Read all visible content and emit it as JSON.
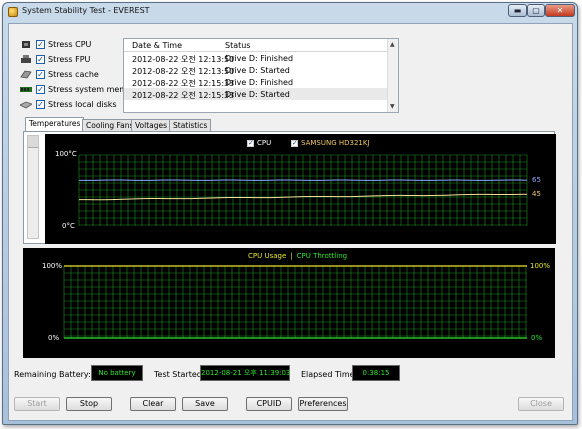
{
  "window": {
    "title": "System Stability Test - EVEREST",
    "min_glyph": "▬",
    "max_glyph": "▢",
    "close_glyph": "✕"
  },
  "stress_options": [
    {
      "label": "Stress CPU",
      "icon": "cpu-icon",
      "checked": "✓"
    },
    {
      "label": "Stress FPU",
      "icon": "fpu-icon",
      "checked": "✓"
    },
    {
      "label": "Stress cache",
      "icon": "cache-icon",
      "checked": "✓"
    },
    {
      "label": "Stress system memory",
      "icon": "memory-icon",
      "checked": "✓"
    },
    {
      "label": "Stress local disks",
      "icon": "disk-icon",
      "checked": "✓"
    }
  ],
  "log": {
    "columns": [
      "Date & Time",
      "Status"
    ],
    "rows": [
      {
        "time": "2012-08-22 오전 12:13:50",
        "status": "Drive D: Finished"
      },
      {
        "time": "2012-08-22 오전 12:13:50",
        "status": "Drive D: Started"
      },
      {
        "time": "2012-08-22 오전 12:15:33",
        "status": "Drive D: Finished"
      },
      {
        "time": "2012-08-22 오전 12:15:33",
        "status": "Drive D: Started"
      }
    ],
    "scroll_up": "▲",
    "scroll_down": "▼"
  },
  "tabs": [
    "Temperatures",
    "Cooling Fans",
    "Voltages",
    "Statistics"
  ],
  "active_tab": "Temperatures",
  "temp_graph": {
    "y_max_label": "100°C",
    "y_min_label": "0°C",
    "legend": [
      {
        "label": "CPU",
        "color": "#ffffff",
        "checked": "✓"
      },
      {
        "label": "SAMSUNG HD321KJ",
        "color": "#f2c86a",
        "checked": "✓"
      }
    ],
    "series_end_values": [
      "65",
      "45"
    ],
    "colors": {
      "grid": "#1f8f1f",
      "cpu": "#8fa6ff",
      "disk": "#f2e0a0"
    }
  },
  "usage_graph": {
    "title_left": "CPU Usage",
    "separator": "|",
    "title_right": "CPU Throttling",
    "y_max_left": "100%",
    "y_min_left": "0%",
    "y_max_right": "100%",
    "y_min_right": "0%",
    "colors": {
      "grid": "#1f8f1f",
      "usage": "#e8e82a",
      "throttling": "#2ee62e"
    }
  },
  "status": {
    "battery_label": "Remaining Battery:",
    "battery_value": "No battery",
    "started_label": "Test Started:",
    "started_value": "2012-08-21 오후 11:39:03",
    "elapsed_label": "Elapsed Time:",
    "elapsed_value": "0:38:15"
  },
  "buttons": {
    "start": "Start",
    "stop": "Stop",
    "clear": "Clear",
    "save": "Save",
    "cpuid": "CPUID",
    "preferences": "Preferences",
    "close": "Close"
  }
}
